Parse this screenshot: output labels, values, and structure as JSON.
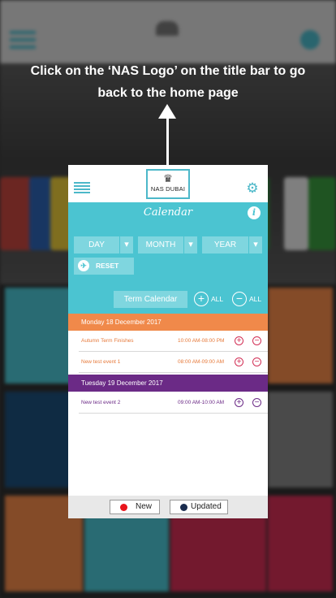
{
  "annotation": {
    "line1": "Click on the ‘NAS Logo’ on the title bar to go",
    "line2": "back to the home page"
  },
  "title_bar": {
    "logo_text": "NAS DUBAI",
    "logo_icon": "crown-icon",
    "menu_icon": "hamburger-menu-icon",
    "settings_icon": "gear-icon"
  },
  "calendar": {
    "title": "Calendar",
    "info_label": "i",
    "filters": {
      "day": "DAY",
      "month": "MONTH",
      "year": "YEAR"
    },
    "reset_label": "RESET",
    "term_calendar_label": "Term Calendar",
    "expand_all_label": "ALL",
    "collapse_all_label": "ALL"
  },
  "days": [
    {
      "header": "Monday 18 December 2017",
      "color": "#f0894a",
      "events": [
        {
          "name": "Autumn Term Finishes",
          "time": "10:00 AM-08:00 PM"
        },
        {
          "name": "New test event 1",
          "time": "08:00 AM-09:00 AM"
        }
      ]
    },
    {
      "header": "Tuesday 19 December 2017",
      "color": "#6b2a86",
      "events": [
        {
          "name": "New test event 2",
          "time": "09:00 AM-10:00 AM"
        }
      ]
    }
  ],
  "legend": {
    "new_label": "New",
    "new_color": "#e8141b",
    "updated_label": "Updated",
    "updated_color": "#1a2c4e"
  },
  "colors": {
    "accent": "#4bc4d1",
    "monday_text": "#e6793a",
    "tuesday_text": "#6b2a86"
  }
}
